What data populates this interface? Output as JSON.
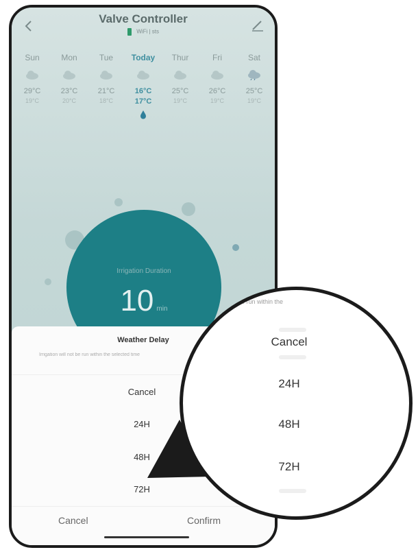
{
  "app": {
    "title": "Valve Controller",
    "status_text": "WiFi",
    "status_sub": "| sts"
  },
  "forecast": [
    {
      "day": "Sun",
      "high": "29°C",
      "low": "19°C"
    },
    {
      "day": "Mon",
      "high": "23°C",
      "low": "20°C"
    },
    {
      "day": "Tue",
      "high": "21°C",
      "low": "18°C"
    },
    {
      "day": "Today",
      "high": "16°C",
      "low": "17°C"
    },
    {
      "day": "Thur",
      "high": "25°C",
      "low": "19°C"
    },
    {
      "day": "Fri",
      "high": "26°C",
      "low": "19°C"
    },
    {
      "day": "Sat",
      "high": "25°C",
      "low": "19°C"
    }
  ],
  "circle": {
    "label": "Irrigation Duration",
    "value": "10",
    "unit": "min"
  },
  "sheet": {
    "title": "Weather Delay",
    "description": "Irrigation will not be run within the selected time",
    "options": [
      "Cancel",
      "24H",
      "48H",
      "72H"
    ],
    "cancel_label": "Cancel",
    "confirm_label": "Confirm"
  },
  "magnifier": {
    "description": "be run within the",
    "options": [
      "Cancel",
      "24H",
      "48H",
      "72H"
    ]
  },
  "colors": {
    "accent": "#1d7f86",
    "today": "#3f8fa0",
    "battery": "#2f9a6b"
  }
}
